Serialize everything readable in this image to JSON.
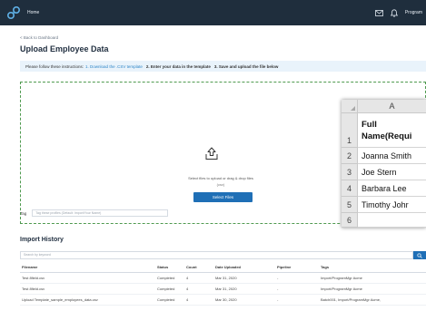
{
  "nav": {
    "home_label": "Home",
    "program_label": "Program"
  },
  "breadcrumb": {
    "back_label": "< Back to Dashboard"
  },
  "page": {
    "title": "Upload Employee Data"
  },
  "instructions": {
    "intro": "Please follow these instructions:",
    "step1": "1. Download the .CSV template",
    "step2": "2. Enter your data in the template",
    "step3": "3. Save and upload the file below"
  },
  "dropzone": {
    "text": "Select files to upload or drag & drop files",
    "subtext": "(csv)",
    "button_label": "Select Files"
  },
  "tag": {
    "label": "Tag",
    "placeholder": "Tag these profiles (Default: Import/Your Name)"
  },
  "history": {
    "title": "Import History",
    "search_placeholder": "Search by keyword",
    "columns": [
      "Filename",
      "Status",
      "Count",
      "Date Uploaded",
      "Pipeline",
      "Tags"
    ],
    "rows": [
      [
        "Test 8field.csv",
        "Completed",
        "4",
        "Mar 31, 2020",
        "-",
        "Import/ProgramMgr Acme"
      ],
      [
        "Test 8field.csv",
        "Completed",
        "4",
        "Mar 31, 2020",
        "-",
        "Import/ProgramMgr Acme"
      ],
      [
        "Upload Template_sample_employees_data.csv",
        "Completed",
        "4",
        "Mar 30, 2020",
        "-",
        "Batch001, Import/ProgramMgr Acme,"
      ]
    ]
  },
  "spreadsheet": {
    "column": "A",
    "header_line1": "Full",
    "header_line2": "Name(Requi",
    "rows": [
      {
        "num": "1",
        "value": ""
      },
      {
        "num": "2",
        "value": "Joanna Smith"
      },
      {
        "num": "3",
        "value": "Joe Stern"
      },
      {
        "num": "4",
        "value": "Barbara Lee"
      },
      {
        "num": "5",
        "value": "Timothy Johr"
      },
      {
        "num": "6",
        "value": ""
      }
    ]
  },
  "colors": {
    "nav_bg": "#1f2e3d",
    "accent_blue": "#1f6fb6",
    "link_blue": "#2f86c7",
    "dropzone_border": "#4f9a4f",
    "instructions_bg": "#e9f3fb"
  },
  "icons": {
    "logo": "brand-logo-icon",
    "mail": "mail-icon",
    "bell": "bell-icon",
    "upload": "upload-icon",
    "search": "search-icon"
  }
}
